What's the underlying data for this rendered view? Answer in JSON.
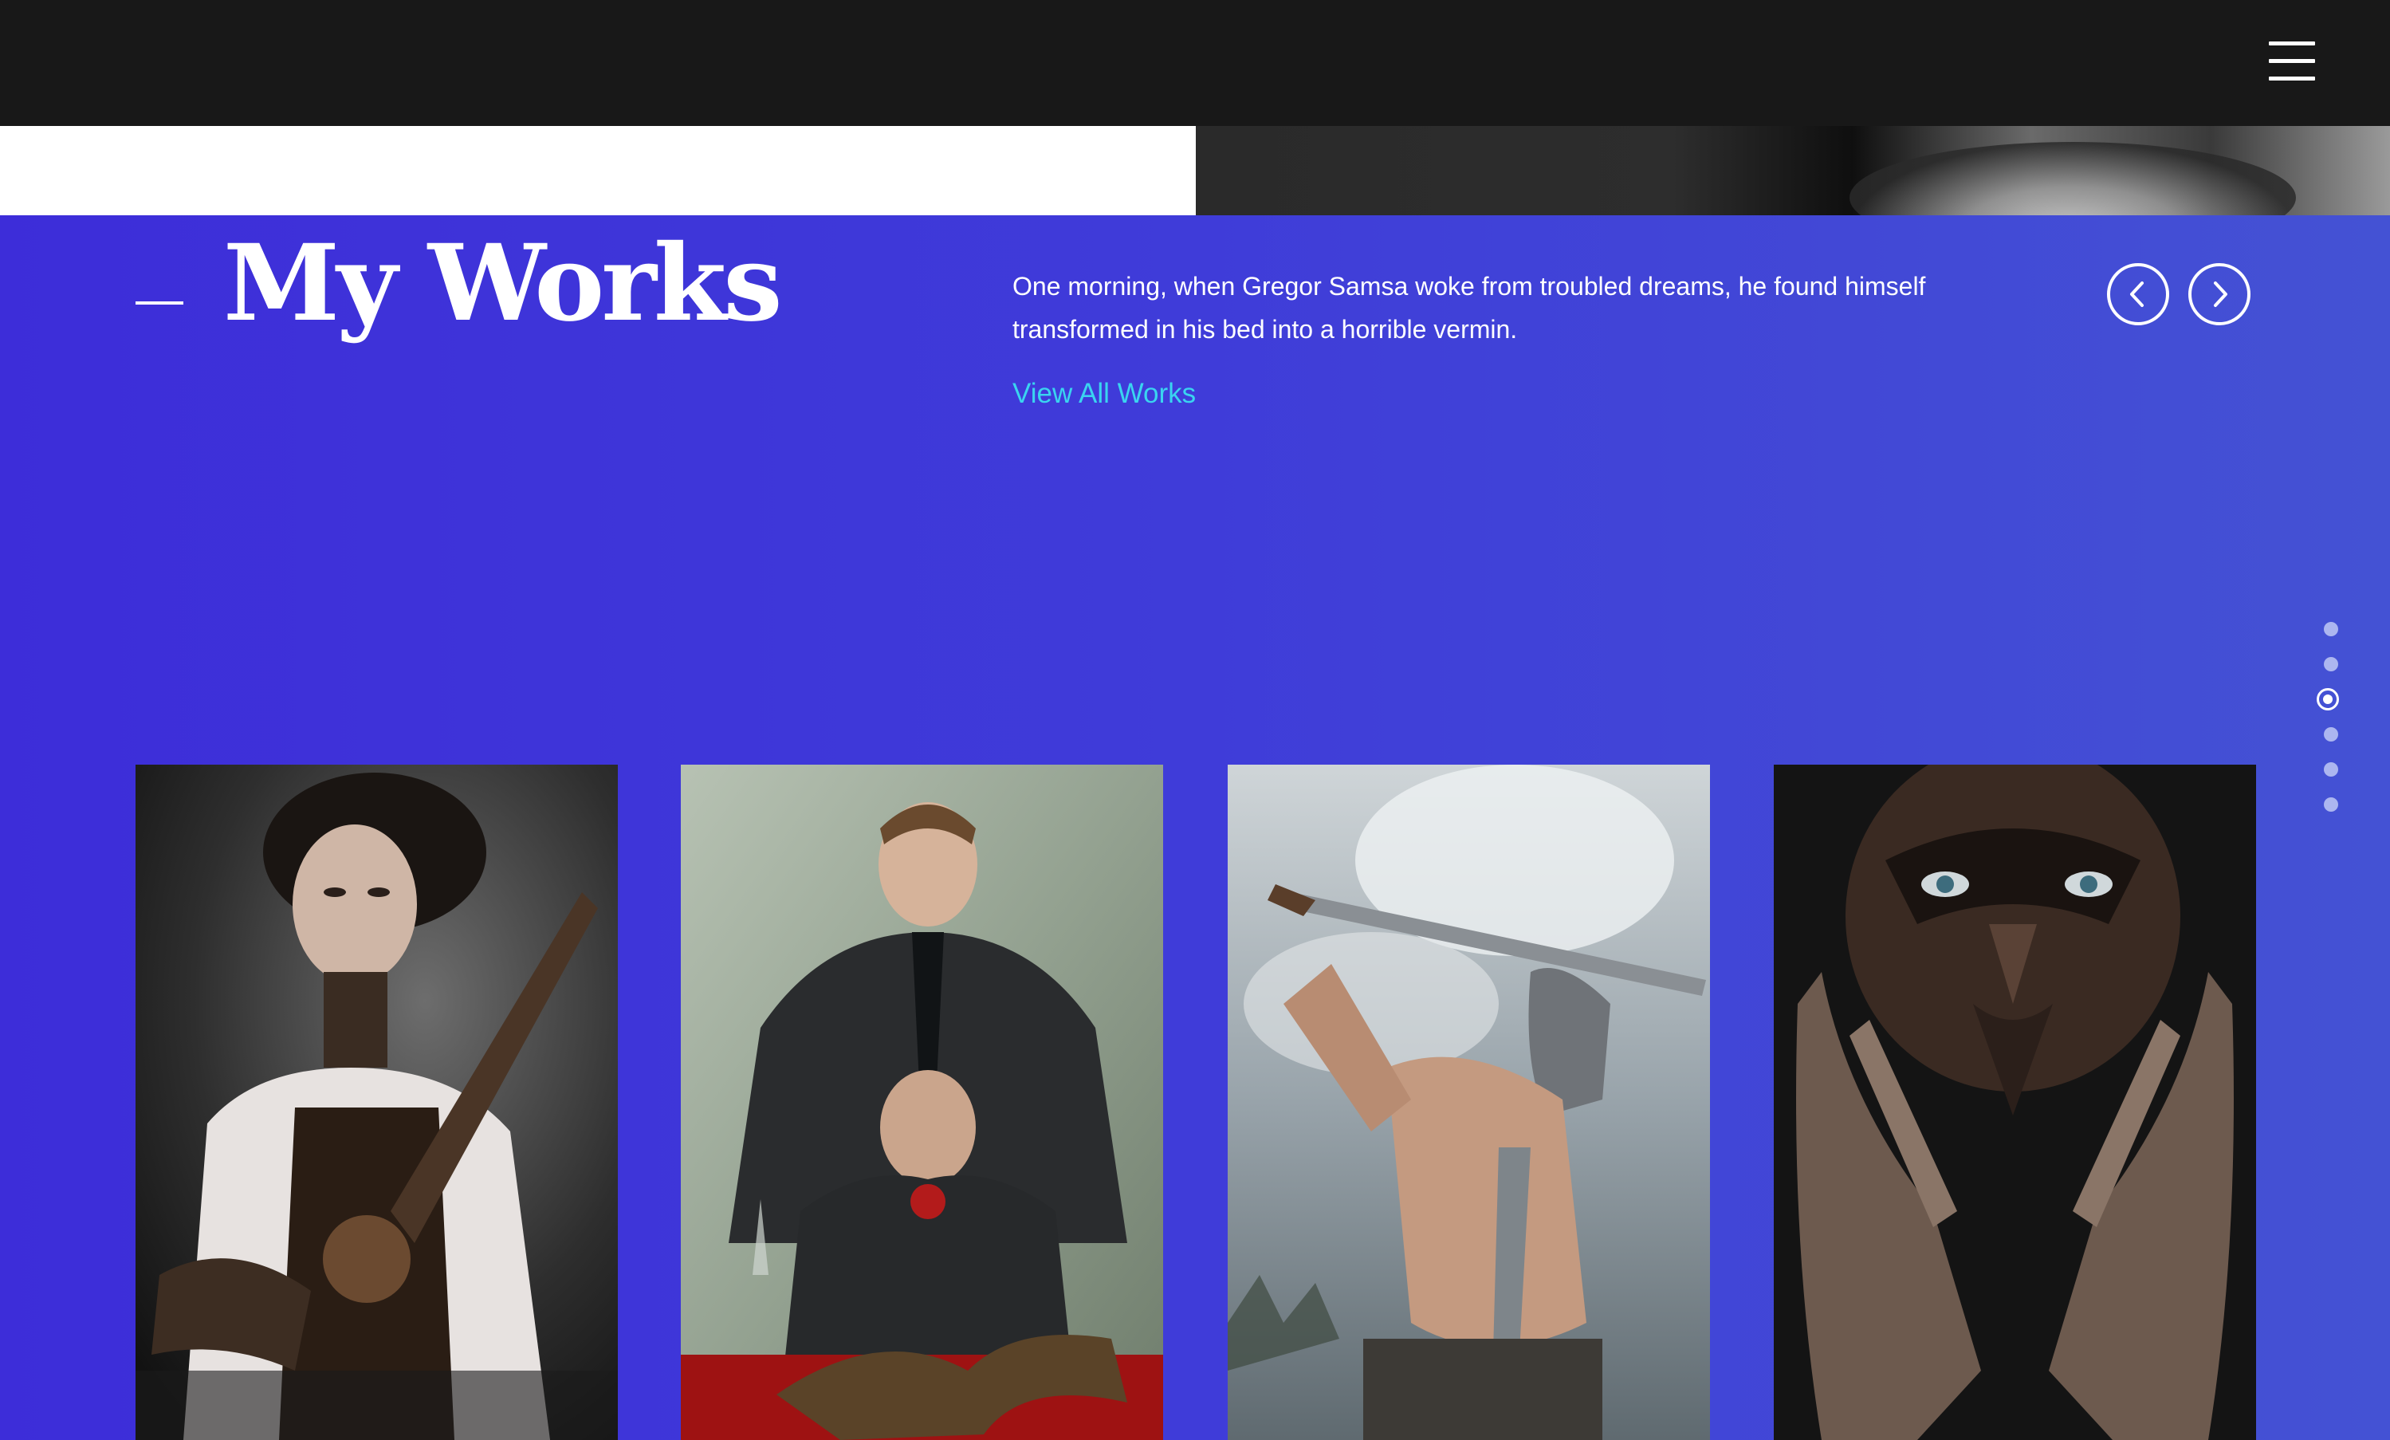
{
  "header": {
    "menu_icon": "hamburger-menu-icon"
  },
  "works": {
    "title": "My Works",
    "description": "One morning, when Gregor Samsa woke from troubled dreams, he found himself transformed in his bed into a horrible vermin.",
    "view_all_label": "View All Works",
    "prev_icon": "chevron-left-icon",
    "next_icon": "chevron-right-icon",
    "colors": {
      "background_start": "#3d2dd9",
      "background_end": "#4452d4",
      "link": "#3ad4f0"
    }
  },
  "pagination": {
    "total": 6,
    "active_index": 2
  },
  "gallery": [
    {
      "subject": "steampunk woman portrait"
    },
    {
      "subject": "two men in suits portrait"
    },
    {
      "subject": "spartan warrior with sword"
    },
    {
      "subject": "face with painted hands"
    }
  ]
}
